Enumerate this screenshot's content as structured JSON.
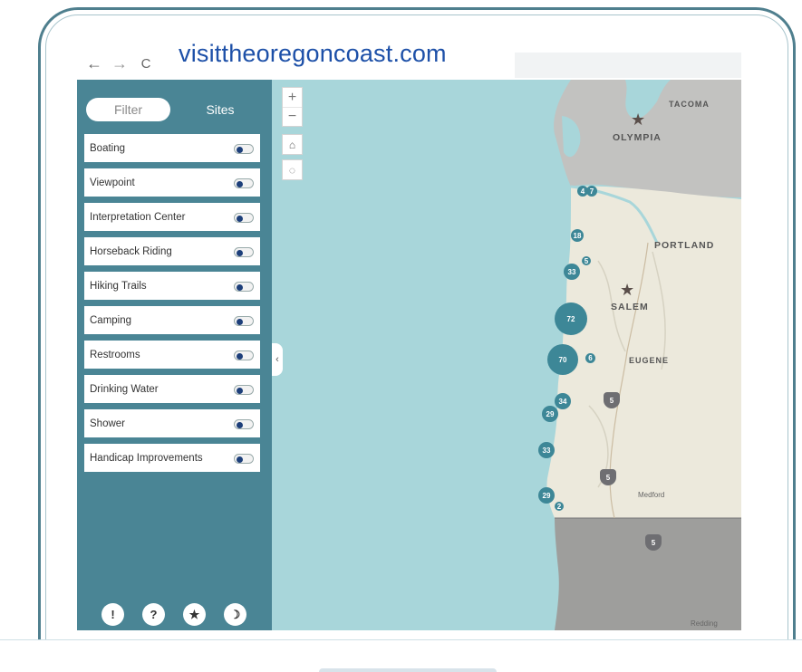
{
  "browser": {
    "back_icon": "arrow-left-icon",
    "forward_icon": "arrow-right-icon",
    "reload_icon": "reload-icon",
    "back_glyph": "←",
    "forward_glyph": "→",
    "reload_glyph": "C",
    "url": "visittheoregoncoast.com"
  },
  "sidebar": {
    "tabs": {
      "filter": "Filter",
      "sites": "Sites"
    },
    "filters": [
      {
        "label": "Boating",
        "on": true
      },
      {
        "label": "Viewpoint",
        "on": true
      },
      {
        "label": "Interpretation Center",
        "on": true
      },
      {
        "label": "Horseback Riding",
        "on": true
      },
      {
        "label": "Hiking Trails",
        "on": true
      },
      {
        "label": "Camping",
        "on": true
      },
      {
        "label": "Restrooms",
        "on": true
      },
      {
        "label": "Drinking Water",
        "on": true
      },
      {
        "label": "Shower",
        "on": true
      },
      {
        "label": "Handicap Improvements",
        "on": true
      }
    ],
    "bottom_buttons": [
      {
        "icon": "info-icon",
        "glyph": "!"
      },
      {
        "icon": "help-icon",
        "glyph": "?"
      },
      {
        "icon": "star-icon",
        "glyph": "★"
      },
      {
        "icon": "moon-icon",
        "glyph": "☽"
      }
    ],
    "collapse_glyph": "‹"
  },
  "map": {
    "zoom_in": "+",
    "zoom_out": "−",
    "home_glyph": "⌂",
    "locate_glyph": "◌",
    "cities": {
      "tacoma": "TACOMA",
      "olympia": "OLYMPIA",
      "portland": "PORTLAND",
      "salem": "SALEM",
      "eugene": "EUGENE",
      "medford": "Medford",
      "redding": "Redding"
    },
    "clusters": [
      "4",
      "7",
      "18",
      "5",
      "33",
      "72",
      "70",
      "6",
      "34",
      "29",
      "33",
      "29",
      "2"
    ],
    "highway_shields": [
      "5",
      "5",
      "5"
    ],
    "colors": {
      "ocean": "#a8d6da",
      "land": "#ece9dc",
      "washington": "#c2c2c0",
      "california": "#9e9e9c",
      "cluster": "#3d8797",
      "sidebar": "#4a8595"
    }
  }
}
